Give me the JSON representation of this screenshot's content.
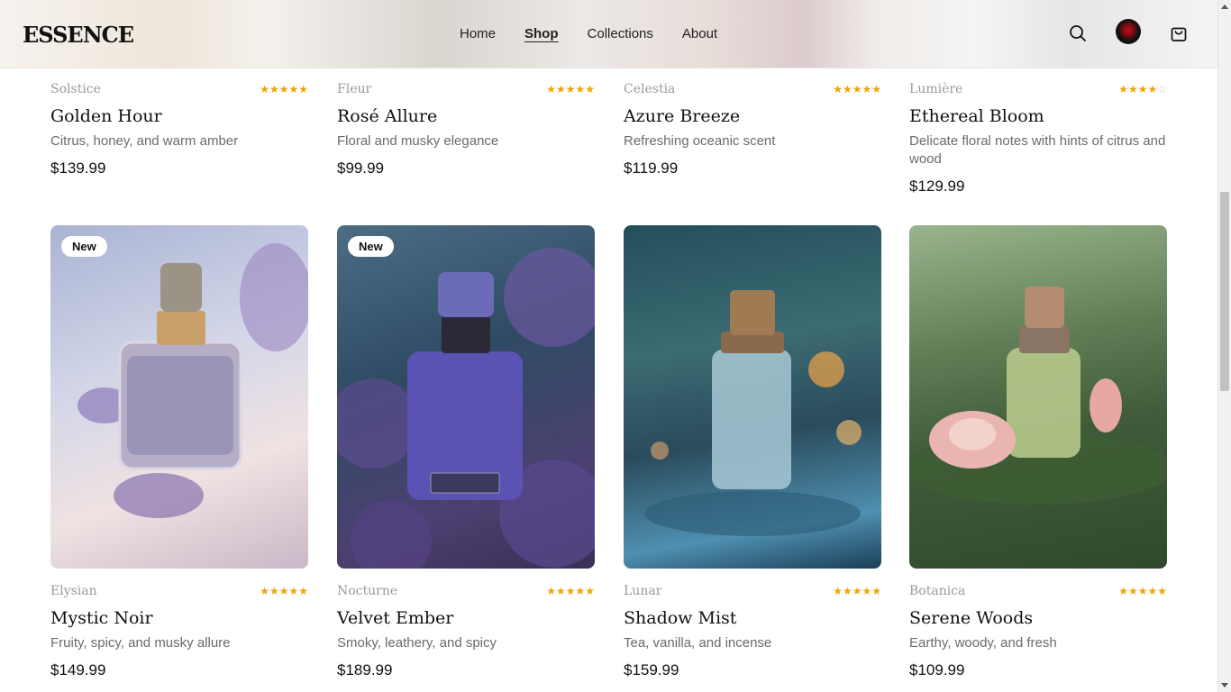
{
  "header": {
    "logo": "ESSENCE",
    "nav": [
      "Home",
      "Shop",
      "Collections",
      "About"
    ],
    "active_nav": "Shop"
  },
  "products_top": [
    {
      "brand": "Solstice",
      "name": "Golden Hour",
      "desc": "Citrus, honey, and warm amber",
      "price": "$139.99",
      "rating": 5
    },
    {
      "brand": "Fleur",
      "name": "Rosé Allure",
      "desc": "Floral and musky elegance",
      "price": "$99.99",
      "rating": 5
    },
    {
      "brand": "Celestia",
      "name": "Azure Breeze",
      "desc": "Refreshing oceanic scent",
      "price": "$119.99",
      "rating": 5
    },
    {
      "brand": "Lumière",
      "name": "Ethereal Bloom",
      "desc": "Delicate floral notes with hints of citrus and wood",
      "price": "$129.99",
      "rating": 4
    }
  ],
  "products_bottom": [
    {
      "brand": "Elysian",
      "name": "Mystic Noir",
      "desc": "Fruity, spicy, and musky allure",
      "price": "$149.99",
      "rating": 5,
      "badge": "New"
    },
    {
      "brand": "Nocturne",
      "name": "Velvet Ember",
      "desc": "Smoky, leathery, and spicy",
      "price": "$189.99",
      "rating": 5,
      "badge": "New"
    },
    {
      "brand": "Lunar",
      "name": "Shadow Mist",
      "desc": "Tea, vanilla, and incense",
      "price": "$159.99",
      "rating": 5
    },
    {
      "brand": "Botanica",
      "name": "Serene Woods",
      "desc": "Earthy, woody, and fresh",
      "price": "$109.99",
      "rating": 5
    }
  ],
  "colors": {
    "star": "#f0a500",
    "text_muted": "#6b6b6b",
    "brand_muted": "#9a9a9a"
  },
  "icons": {
    "search": "search-icon",
    "avatar": "user-avatar",
    "cart": "shopping-bag-icon"
  }
}
